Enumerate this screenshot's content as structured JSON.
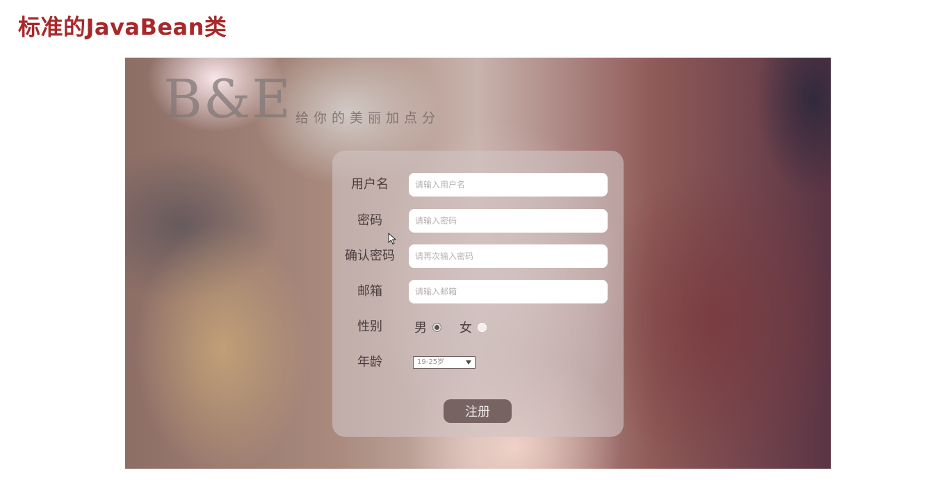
{
  "slide": {
    "title": "标准的JavaBean类"
  },
  "banner": {
    "logo": "B&E",
    "slogan": "给你的美丽加点分"
  },
  "form": {
    "username": {
      "label": "用户名",
      "placeholder": "请输入用户名"
    },
    "password": {
      "label": "密码",
      "placeholder": "请输入密码"
    },
    "confirm": {
      "label": "确认密码",
      "placeholder": "请再次输入密码"
    },
    "email": {
      "label": "邮箱",
      "placeholder": "请输入邮箱"
    },
    "gender": {
      "label": "性别",
      "options": [
        {
          "label": "男",
          "checked": true
        },
        {
          "label": "女",
          "checked": false
        }
      ]
    },
    "age": {
      "label": "年龄",
      "selected": "19-25岁"
    },
    "submit_label": "注册"
  },
  "icons": {
    "cursor": "mouse-pointer-icon",
    "dropdown": "dropdown-arrow-icon",
    "radio": "radio-icon"
  }
}
